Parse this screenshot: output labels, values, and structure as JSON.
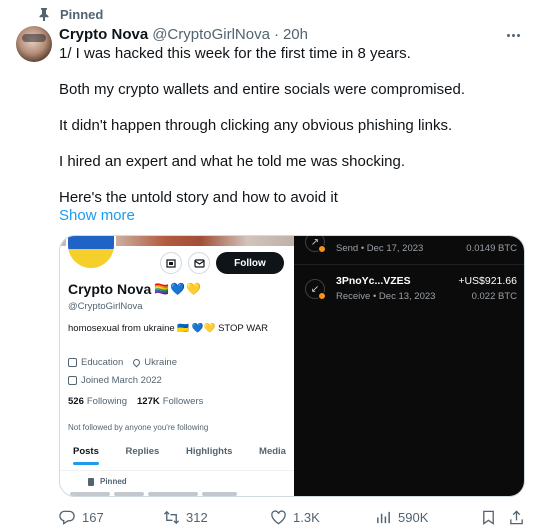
{
  "pinned": {
    "label": "Pinned"
  },
  "post": {
    "author_name": "Crypto Nova",
    "author_handle": "@CryptoGirlNova",
    "separator": "·",
    "time": "20h",
    "lines": [
      "1/ I was hacked this week for the first time in 8 years.",
      "Both my crypto wallets and entire socials were compromised.",
      "It didn't happen through clicking any obvious phishing links.",
      "I hired an expert and what he told me was shocking.",
      "Here's the untold story and how to avoid it"
    ],
    "show_more": "Show more"
  },
  "profile_card": {
    "follow_label": "Follow",
    "name": "Crypto Nova",
    "name_emojis": "🏳️‍🌈💙💛",
    "handle": "@CryptoGirlNova",
    "bio": "homosexual from ukraine 🇺🇦 💙💛 STOP WAR",
    "category": "Education",
    "location": "Ukraine",
    "joined": "Joined March 2022",
    "following_count": "526",
    "following_label": "Following",
    "followers_count": "127K",
    "followers_label": "Followers",
    "not_followed": "Not followed by anyone you're following",
    "tabs": [
      "Posts",
      "Replies",
      "Highlights",
      "Media"
    ],
    "active_tab": "Posts",
    "pinned_label": "Pinned"
  },
  "wallet": {
    "transactions": [
      {
        "title": "",
        "subtitle": "Send • Dec 17, 2023",
        "amount": "",
        "btc": "0.0149 BTC",
        "direction": "send"
      },
      {
        "title": "3PnoYc...VZES",
        "subtitle": "Receive • Dec 13, 2023",
        "amount": "+US$921.66",
        "btc": "0.022 BTC",
        "direction": "receive"
      }
    ],
    "badge_color": "#f7931a"
  },
  "actions": {
    "replies": "167",
    "reposts": "312",
    "likes": "1.3K",
    "views": "590K"
  },
  "colors": {
    "accent": "#1d9bf0",
    "text_primary": "#0f1419",
    "text_secondary": "#536471"
  }
}
